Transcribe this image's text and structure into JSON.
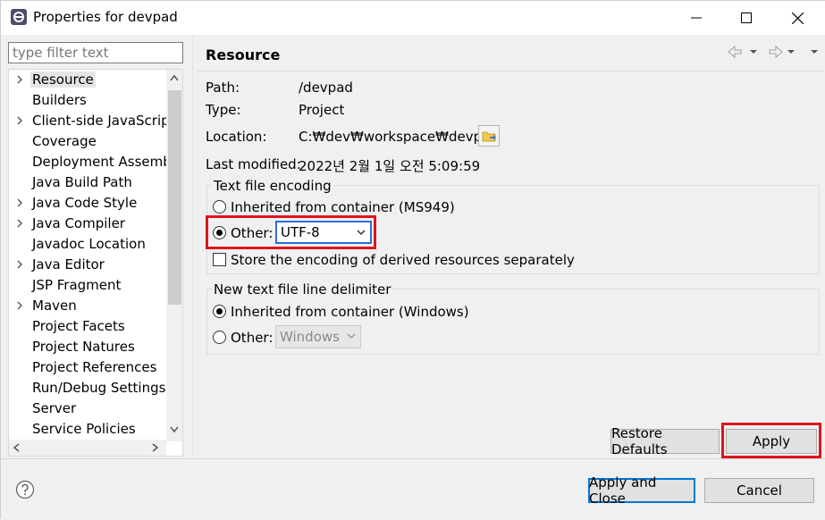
{
  "window": {
    "title": "Properties for devpad",
    "controls": {
      "minimize": "minimize",
      "maximize": "maximize",
      "close": "close"
    }
  },
  "filter": {
    "placeholder": "type filter text"
  },
  "tree": {
    "items": [
      {
        "label": "Resource",
        "expandable": true,
        "selected": true
      },
      {
        "label": "Builders",
        "expandable": false
      },
      {
        "label": "Client-side JavaScript",
        "expandable": true
      },
      {
        "label": "Coverage",
        "expandable": false
      },
      {
        "label": "Deployment Assembly",
        "expandable": false
      },
      {
        "label": "Java Build Path",
        "expandable": false
      },
      {
        "label": "Java Code Style",
        "expandable": true
      },
      {
        "label": "Java Compiler",
        "expandable": true
      },
      {
        "label": "Javadoc Location",
        "expandable": false
      },
      {
        "label": "Java Editor",
        "expandable": true
      },
      {
        "label": "JSP Fragment",
        "expandable": false
      },
      {
        "label": "Maven",
        "expandable": true
      },
      {
        "label": "Project Facets",
        "expandable": false
      },
      {
        "label": "Project Natures",
        "expandable": false
      },
      {
        "label": "Project References",
        "expandable": false
      },
      {
        "label": "Run/Debug Settings",
        "expandable": false
      },
      {
        "label": "Server",
        "expandable": false
      },
      {
        "label": "Service Policies",
        "expandable": false
      }
    ]
  },
  "panel": {
    "title": "Resource",
    "path_label": "Path:",
    "path_value": "/devpad",
    "type_label": "Type:",
    "type_value": "Project",
    "location_label": "Location:",
    "location_value": "C:₩dev₩workspace₩devpad",
    "modified_label": "Last modified:",
    "modified_value": "2022년 2월 1일 오전 5:09:59",
    "encoding": {
      "group_title": "Text file encoding",
      "inherited_label": "Inherited from container (MS949)",
      "other_label": "Other:",
      "other_value": "UTF-8",
      "store_label": "Store the encoding of derived resources separately"
    },
    "delimiter": {
      "group_title": "New text file line delimiter",
      "inherited_label": "Inherited from container (Windows)",
      "other_label": "Other:",
      "other_value": "Windows"
    },
    "restore_defaults": "Restore Defaults",
    "apply": "Apply"
  },
  "footer": {
    "help_icon": "help-icon",
    "apply_close": "Apply and Close",
    "cancel": "Cancel"
  },
  "colors": {
    "highlight": "#e0141e",
    "focus": "#2a6fd6"
  }
}
